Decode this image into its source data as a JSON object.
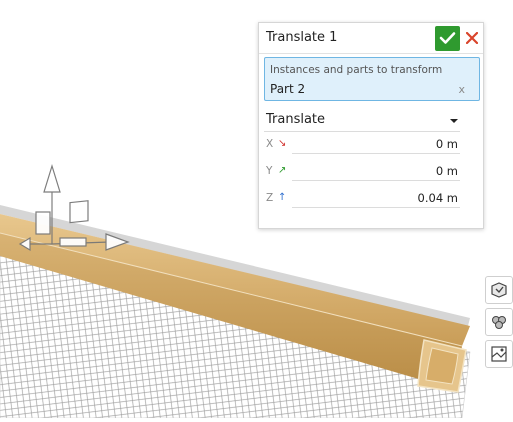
{
  "dialog": {
    "title": "Translate 1",
    "accept_icon": "checkmark-icon",
    "cancel_icon": "close-icon",
    "accent_color": "#2f9a2f",
    "cancel_color": "#d9442b",
    "selection": {
      "label": "Instances and parts to transform",
      "item": "Part 2",
      "clear_label": "x"
    },
    "mode": {
      "value": "Translate"
    },
    "fields": [
      {
        "axis": "X",
        "arrow": "↘",
        "arrow_color": "#d0312d",
        "value": "0 m"
      },
      {
        "axis": "Y",
        "arrow": "↗",
        "arrow_color": "#2e9a2e",
        "value": "0 m"
      },
      {
        "axis": "Z",
        "arrow": "↑",
        "arrow_color": "#2f6fcf",
        "value": "0.04 m"
      }
    ]
  },
  "side_toolbar": [
    {
      "icon": "view-cube-icon"
    },
    {
      "icon": "appearance-icon"
    },
    {
      "icon": "section-view-icon"
    }
  ],
  "scene": {
    "part_color": "#d8b47a",
    "mesh_color": "#9a9a9a",
    "manipulator": "triad-manipulator"
  }
}
